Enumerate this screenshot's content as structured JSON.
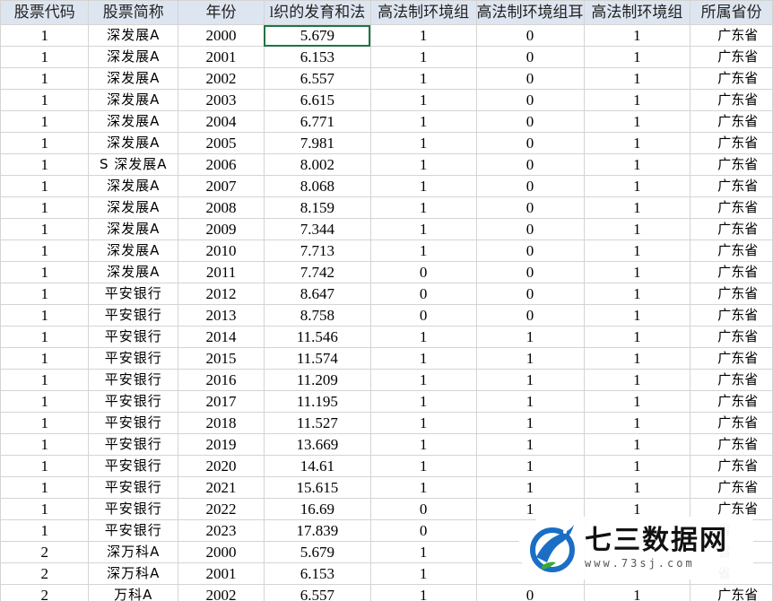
{
  "columns": [
    "股票代码",
    "股票简称",
    "年份",
    "l织的发育和法",
    "高法制环境组",
    "高法制环境组耳",
    "高法制环境组",
    "所属省份"
  ],
  "rows": [
    [
      "1",
      "深发展A",
      "2000",
      "5.679",
      "1",
      "0",
      "1",
      "广东省"
    ],
    [
      "1",
      "深发展A",
      "2001",
      "6.153",
      "1",
      "0",
      "1",
      "广东省"
    ],
    [
      "1",
      "深发展A",
      "2002",
      "6.557",
      "1",
      "0",
      "1",
      "广东省"
    ],
    [
      "1",
      "深发展A",
      "2003",
      "6.615",
      "1",
      "0",
      "1",
      "广东省"
    ],
    [
      "1",
      "深发展A",
      "2004",
      "6.771",
      "1",
      "0",
      "1",
      "广东省"
    ],
    [
      "1",
      "深发展A",
      "2005",
      "7.981",
      "1",
      "0",
      "1",
      "广东省"
    ],
    [
      "1",
      "S 深发展A",
      "2006",
      "8.002",
      "1",
      "0",
      "1",
      "广东省"
    ],
    [
      "1",
      "深发展A",
      "2007",
      "8.068",
      "1",
      "0",
      "1",
      "广东省"
    ],
    [
      "1",
      "深发展A",
      "2008",
      "8.159",
      "1",
      "0",
      "1",
      "广东省"
    ],
    [
      "1",
      "深发展A",
      "2009",
      "7.344",
      "1",
      "0",
      "1",
      "广东省"
    ],
    [
      "1",
      "深发展A",
      "2010",
      "7.713",
      "1",
      "0",
      "1",
      "广东省"
    ],
    [
      "1",
      "深发展A",
      "2011",
      "7.742",
      "0",
      "0",
      "1",
      "广东省"
    ],
    [
      "1",
      "平安银行",
      "2012",
      "8.647",
      "0",
      "0",
      "1",
      "广东省"
    ],
    [
      "1",
      "平安银行",
      "2013",
      "8.758",
      "0",
      "0",
      "1",
      "广东省"
    ],
    [
      "1",
      "平安银行",
      "2014",
      "11.546",
      "1",
      "1",
      "1",
      "广东省"
    ],
    [
      "1",
      "平安银行",
      "2015",
      "11.574",
      "1",
      "1",
      "1",
      "广东省"
    ],
    [
      "1",
      "平安银行",
      "2016",
      "11.209",
      "1",
      "1",
      "1",
      "广东省"
    ],
    [
      "1",
      "平安银行",
      "2017",
      "11.195",
      "1",
      "1",
      "1",
      "广东省"
    ],
    [
      "1",
      "平安银行",
      "2018",
      "11.527",
      "1",
      "1",
      "1",
      "广东省"
    ],
    [
      "1",
      "平安银行",
      "2019",
      "13.669",
      "1",
      "1",
      "1",
      "广东省"
    ],
    [
      "1",
      "平安银行",
      "2020",
      "14.61",
      "1",
      "1",
      "1",
      "广东省"
    ],
    [
      "1",
      "平安银行",
      "2021",
      "15.615",
      "1",
      "1",
      "1",
      "广东省"
    ],
    [
      "1",
      "平安银行",
      "2022",
      "16.69",
      "0",
      "1",
      "1",
      "广东省"
    ],
    [
      "1",
      "平安银行",
      "2023",
      "17.839",
      "0",
      "",
      "",
      "省"
    ],
    [
      "2",
      "深万科A",
      "2000",
      "5.679",
      "1",
      "",
      "",
      "省"
    ],
    [
      "2",
      "深万科A",
      "2001",
      "6.153",
      "1",
      "",
      "",
      "省"
    ],
    [
      "2",
      "万科A",
      "2002",
      "6.557",
      "1",
      "0",
      "1",
      "广东省"
    ]
  ],
  "selected_cell": {
    "row": 0,
    "col": 3
  },
  "watermark": {
    "title": "七三数据网",
    "url": "www.73sj.com",
    "logo_icon": "blue-dragon-logo-icon",
    "colors": {
      "blue": "#1a6fc4",
      "green": "#3aa935"
    }
  }
}
